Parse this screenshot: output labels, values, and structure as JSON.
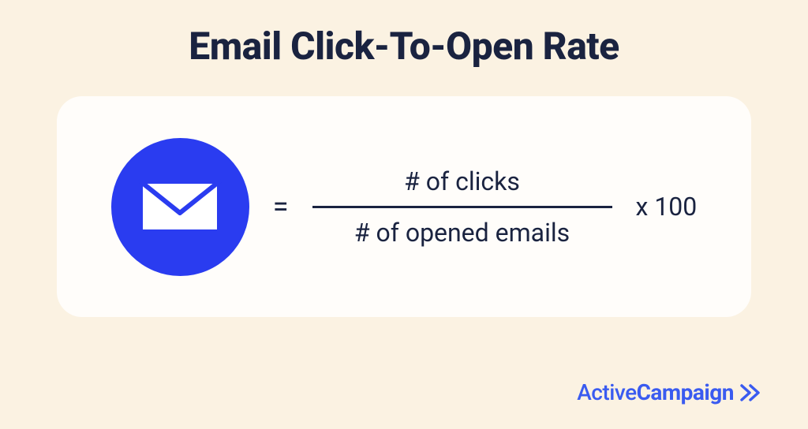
{
  "title": "Email Click-To-Open Rate",
  "formula": {
    "equals_sign": "=",
    "numerator": "# of clicks",
    "denominator": "# of opened emails",
    "multiply_suffix": "x 100"
  },
  "brand": {
    "name_part1": "Active",
    "name_part2": "Campaign"
  },
  "colors": {
    "background": "#fbf2e2",
    "card": "#fffdfa",
    "text_dark": "#1a2340",
    "accent_blue": "#2a3cf0",
    "brand_blue": "#3a5bf0"
  }
}
